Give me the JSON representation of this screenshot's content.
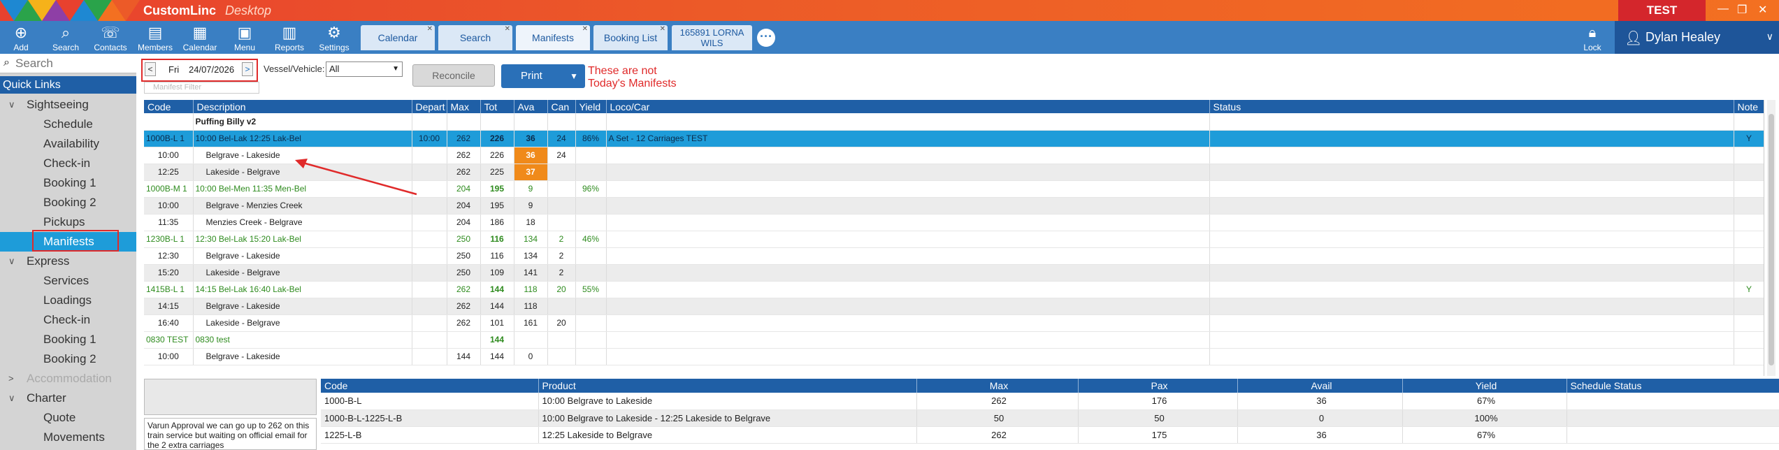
{
  "app": {
    "title": "CustomLinc",
    "subtitle": "Desktop",
    "env": "TEST"
  },
  "toolbar": {
    "tools": [
      {
        "label": "Add",
        "icon": "add-icon"
      },
      {
        "label": "Search",
        "icon": "search-icon"
      },
      {
        "label": "Contacts",
        "icon": "contacts-icon"
      },
      {
        "label": "Members",
        "icon": "members-icon"
      },
      {
        "label": "Calendar",
        "icon": "calendar-icon"
      },
      {
        "label": "Menu",
        "icon": "menu-icon"
      },
      {
        "label": "Reports",
        "icon": "reports-icon"
      },
      {
        "label": "Settings",
        "icon": "gear-icon"
      }
    ],
    "tabs": [
      {
        "label": "Calendar"
      },
      {
        "label": "Search"
      },
      {
        "label": "Manifests"
      },
      {
        "label": "Booking List"
      },
      {
        "line1": "165891 LORNA",
        "line2": "WILS"
      }
    ],
    "lock_label": "Lock",
    "user_name": "Dylan Healey"
  },
  "sidebar": {
    "search_placeholder": "Search",
    "quick_links": "Quick Links",
    "items": [
      {
        "label": "Sightseeing",
        "type": "sec",
        "chev": "∨"
      },
      {
        "label": "Schedule",
        "type": "sub"
      },
      {
        "label": "Availability",
        "type": "sub"
      },
      {
        "label": "Check-in",
        "type": "sub"
      },
      {
        "label": "Booking 1",
        "type": "sub"
      },
      {
        "label": "Booking 2",
        "type": "sub"
      },
      {
        "label": "Pickups",
        "type": "sub"
      },
      {
        "label": "Manifests",
        "type": "sub",
        "active": true
      },
      {
        "label": "Express",
        "type": "sec",
        "chev": "∨"
      },
      {
        "label": "Services",
        "type": "sub"
      },
      {
        "label": "Loadings",
        "type": "sub"
      },
      {
        "label": "Check-in",
        "type": "sub"
      },
      {
        "label": "Booking 1",
        "type": "sub"
      },
      {
        "label": "Booking 2",
        "type": "sub"
      },
      {
        "label": "Accommodation",
        "type": "sec",
        "chev": ">",
        "disabled": true
      },
      {
        "label": "Charter",
        "type": "sec",
        "chev": "∨"
      },
      {
        "label": "Quote",
        "type": "sub"
      },
      {
        "label": "Movements",
        "type": "sub"
      }
    ]
  },
  "controls": {
    "prev": "<",
    "next": ">",
    "day": "Fri",
    "date": "24/07/2026",
    "filter_placeholder": "Manifest Filter",
    "vessel_label": "Vessel/Vehicle:",
    "vessel_value": "All",
    "reconcile": "Reconcile",
    "print": "Print",
    "warning_line1": "These are not",
    "warning_line2": "Today's Manifests"
  },
  "grid": {
    "columns": [
      "Code",
      "Description",
      "Depart",
      "Max",
      "Tot",
      "Ava",
      "Can",
      "Yield",
      "Loco/Car",
      "Status",
      "Note"
    ],
    "rows": [
      {
        "style": "hdr",
        "cells": [
          "",
          "Puffing Billy v2",
          "",
          "",
          "",
          "",
          "",
          "",
          "",
          "",
          ""
        ]
      },
      {
        "style": "sel",
        "cells": [
          "1000B-L 1",
          "10:00 Bel-Lak 12:25 Lak-Bel",
          "10:00",
          "262",
          "226",
          "36",
          "24",
          "86%",
          "A Set - 12 Carriages TEST",
          "",
          "Y"
        ]
      },
      {
        "style": "white",
        "cells": [
          "10:00",
          "Belgrave - Lakeside",
          "",
          "262",
          "226",
          "36",
          "24",
          "",
          "",
          "",
          ""
        ],
        "orange": true
      },
      {
        "style": "alt",
        "cells": [
          "12:25",
          "Lakeside - Belgrave",
          "",
          "262",
          "225",
          "37",
          "",
          "",
          "",
          "",
          ""
        ],
        "orange": true
      },
      {
        "style": "green",
        "cells": [
          "1000B-M 1",
          "10:00 Bel-Men 11:35 Men-Bel",
          "",
          "204",
          "195",
          "9",
          "",
          "96%",
          "",
          "",
          ""
        ]
      },
      {
        "style": "alt",
        "cells": [
          "10:00",
          "Belgrave - Menzies Creek",
          "",
          "204",
          "195",
          "9",
          "",
          "",
          "",
          "",
          ""
        ]
      },
      {
        "style": "white",
        "cells": [
          "11:35",
          "Menzies Creek - Belgrave",
          "",
          "204",
          "186",
          "18",
          "",
          "",
          "",
          "",
          ""
        ]
      },
      {
        "style": "green",
        "cells": [
          "1230B-L 1",
          "12:30 Bel-Lak 15:20 Lak-Bel",
          "",
          "250",
          "116",
          "134",
          "2",
          "46%",
          "",
          "",
          ""
        ]
      },
      {
        "style": "white",
        "cells": [
          "12:30",
          "Belgrave - Lakeside",
          "",
          "250",
          "116",
          "134",
          "2",
          "",
          "",
          "",
          ""
        ]
      },
      {
        "style": "alt",
        "cells": [
          "15:20",
          "Lakeside - Belgrave",
          "",
          "250",
          "109",
          "141",
          "2",
          "",
          "",
          "",
          ""
        ]
      },
      {
        "style": "green",
        "cells": [
          "1415B-L 1",
          "14:15 Bel-Lak 16:40 Lak-Bel",
          "",
          "262",
          "144",
          "118",
          "20",
          "55%",
          "",
          "",
          "Y"
        ]
      },
      {
        "style": "alt",
        "cells": [
          "14:15",
          "Belgrave - Lakeside",
          "",
          "262",
          "144",
          "118",
          "",
          "",
          "",
          "",
          ""
        ]
      },
      {
        "style": "white",
        "cells": [
          "16:40",
          "Lakeside - Belgrave",
          "",
          "262",
          "101",
          "161",
          "20",
          "",
          "",
          "",
          ""
        ]
      },
      {
        "style": "green",
        "cells": [
          "0830 TEST",
          "0830  test",
          "",
          "",
          "144",
          "",
          "",
          "",
          "",
          "",
          ""
        ]
      },
      {
        "style": "white",
        "cells": [
          "10:00",
          "Belgrave - Lakeside",
          "",
          "144",
          "144",
          "0",
          "",
          "",
          "",
          "",
          ""
        ]
      }
    ]
  },
  "note": {
    "text": "Varun Approval we can go up to 262 on this train service but waiting on official email for the 2 extra carriages"
  },
  "bottom": {
    "columns": [
      "Code",
      "Product",
      "Max",
      "Pax",
      "Avail",
      "Yield",
      "Schedule Status"
    ],
    "rows": [
      [
        "1000-B-L",
        "10:00 Belgrave to Lakeside",
        "262",
        "176",
        "36",
        "67%",
        ""
      ],
      [
        "1000-B-L-1225-L-B",
        "10:00 Belgrave to Lakeside - 12:25 Lakeside to Belgrave",
        "50",
        "50",
        "0",
        "100%",
        ""
      ],
      [
        "1225-L-B",
        "12:25 Lakeside to Belgrave",
        "262",
        "175",
        "36",
        "67%",
        ""
      ]
    ]
  }
}
